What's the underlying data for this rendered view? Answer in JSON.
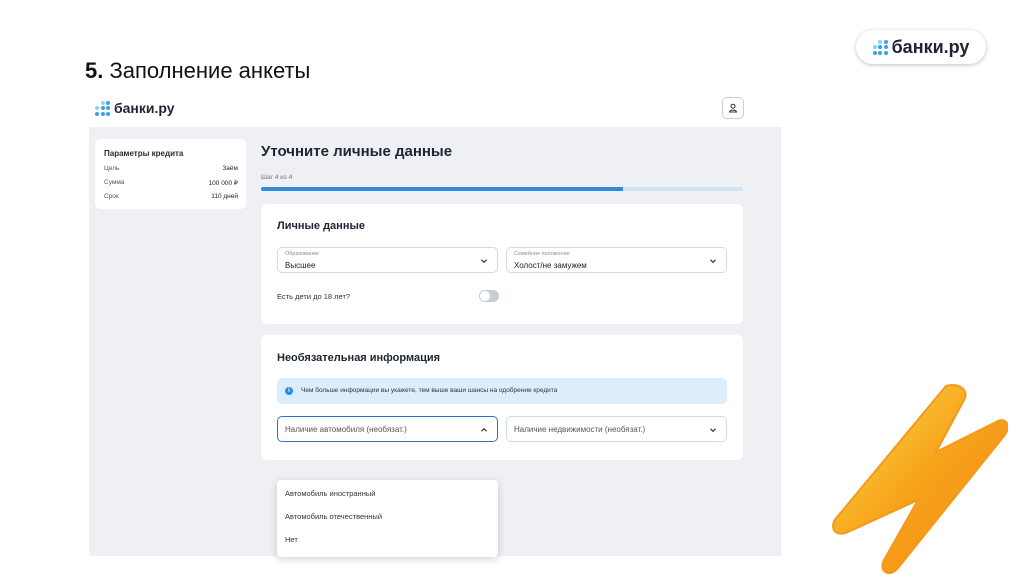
{
  "slide": {
    "number": "5.",
    "title": "Заполнение анкеты"
  },
  "brand": {
    "name": "банки.ру"
  },
  "app": {
    "logo": "банки.ру",
    "user_icon": "user-icon"
  },
  "params": {
    "title": "Параметры кредита",
    "rows": [
      {
        "label": "Цель",
        "value": "Заём"
      },
      {
        "label": "Сумма",
        "value": "100 000 ₽"
      },
      {
        "label": "Срок",
        "value": "110 дней"
      }
    ]
  },
  "form": {
    "title": "Уточните личные данные",
    "step": "Шаг 4 из 4",
    "progress": 0.75,
    "personal": {
      "title": "Личные данные",
      "education": {
        "label": "Образование",
        "value": "Высшее"
      },
      "marital": {
        "label": "Семейное положение",
        "value": "Холост/не замужем"
      },
      "children_label": "Есть дети до 18 лет?",
      "children_on": false
    },
    "optional": {
      "title": "Необязательная информация",
      "info": "Чем больше информации вы укажете, тем выше ваши шансы на одобрение кредита",
      "car": {
        "placeholder": "Наличие автомобиля (необязат.)"
      },
      "realty": {
        "placeholder": "Наличие недвижимости (необязат.)"
      },
      "car_options": [
        "Автомобиль иностранный",
        "Автомобиль отечественный",
        "Нет"
      ]
    }
  },
  "colors": {
    "accent": "#2f8be0",
    "brand": "#3aa0ea",
    "bolt": "#f7a21b"
  }
}
